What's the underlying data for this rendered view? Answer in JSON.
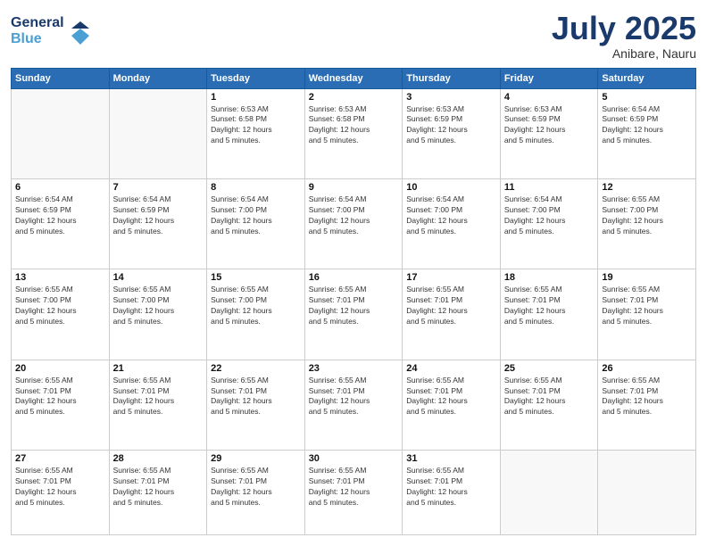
{
  "logo": {
    "line1": "General",
    "line2": "Blue"
  },
  "title": "July 2025",
  "location": "Anibare, Nauru",
  "days_header": [
    "Sunday",
    "Monday",
    "Tuesday",
    "Wednesday",
    "Thursday",
    "Friday",
    "Saturday"
  ],
  "weeks": [
    [
      {
        "day": "",
        "info": ""
      },
      {
        "day": "",
        "info": ""
      },
      {
        "day": "1",
        "info": "Sunrise: 6:53 AM\nSunset: 6:58 PM\nDaylight: 12 hours\nand 5 minutes."
      },
      {
        "day": "2",
        "info": "Sunrise: 6:53 AM\nSunset: 6:58 PM\nDaylight: 12 hours\nand 5 minutes."
      },
      {
        "day": "3",
        "info": "Sunrise: 6:53 AM\nSunset: 6:59 PM\nDaylight: 12 hours\nand 5 minutes."
      },
      {
        "day": "4",
        "info": "Sunrise: 6:53 AM\nSunset: 6:59 PM\nDaylight: 12 hours\nand 5 minutes."
      },
      {
        "day": "5",
        "info": "Sunrise: 6:54 AM\nSunset: 6:59 PM\nDaylight: 12 hours\nand 5 minutes."
      }
    ],
    [
      {
        "day": "6",
        "info": "Sunrise: 6:54 AM\nSunset: 6:59 PM\nDaylight: 12 hours\nand 5 minutes."
      },
      {
        "day": "7",
        "info": "Sunrise: 6:54 AM\nSunset: 6:59 PM\nDaylight: 12 hours\nand 5 minutes."
      },
      {
        "day": "8",
        "info": "Sunrise: 6:54 AM\nSunset: 7:00 PM\nDaylight: 12 hours\nand 5 minutes."
      },
      {
        "day": "9",
        "info": "Sunrise: 6:54 AM\nSunset: 7:00 PM\nDaylight: 12 hours\nand 5 minutes."
      },
      {
        "day": "10",
        "info": "Sunrise: 6:54 AM\nSunset: 7:00 PM\nDaylight: 12 hours\nand 5 minutes."
      },
      {
        "day": "11",
        "info": "Sunrise: 6:54 AM\nSunset: 7:00 PM\nDaylight: 12 hours\nand 5 minutes."
      },
      {
        "day": "12",
        "info": "Sunrise: 6:55 AM\nSunset: 7:00 PM\nDaylight: 12 hours\nand 5 minutes."
      }
    ],
    [
      {
        "day": "13",
        "info": "Sunrise: 6:55 AM\nSunset: 7:00 PM\nDaylight: 12 hours\nand 5 minutes."
      },
      {
        "day": "14",
        "info": "Sunrise: 6:55 AM\nSunset: 7:00 PM\nDaylight: 12 hours\nand 5 minutes."
      },
      {
        "day": "15",
        "info": "Sunrise: 6:55 AM\nSunset: 7:00 PM\nDaylight: 12 hours\nand 5 minutes."
      },
      {
        "day": "16",
        "info": "Sunrise: 6:55 AM\nSunset: 7:01 PM\nDaylight: 12 hours\nand 5 minutes."
      },
      {
        "day": "17",
        "info": "Sunrise: 6:55 AM\nSunset: 7:01 PM\nDaylight: 12 hours\nand 5 minutes."
      },
      {
        "day": "18",
        "info": "Sunrise: 6:55 AM\nSunset: 7:01 PM\nDaylight: 12 hours\nand 5 minutes."
      },
      {
        "day": "19",
        "info": "Sunrise: 6:55 AM\nSunset: 7:01 PM\nDaylight: 12 hours\nand 5 minutes."
      }
    ],
    [
      {
        "day": "20",
        "info": "Sunrise: 6:55 AM\nSunset: 7:01 PM\nDaylight: 12 hours\nand 5 minutes."
      },
      {
        "day": "21",
        "info": "Sunrise: 6:55 AM\nSunset: 7:01 PM\nDaylight: 12 hours\nand 5 minutes."
      },
      {
        "day": "22",
        "info": "Sunrise: 6:55 AM\nSunset: 7:01 PM\nDaylight: 12 hours\nand 5 minutes."
      },
      {
        "day": "23",
        "info": "Sunrise: 6:55 AM\nSunset: 7:01 PM\nDaylight: 12 hours\nand 5 minutes."
      },
      {
        "day": "24",
        "info": "Sunrise: 6:55 AM\nSunset: 7:01 PM\nDaylight: 12 hours\nand 5 minutes."
      },
      {
        "day": "25",
        "info": "Sunrise: 6:55 AM\nSunset: 7:01 PM\nDaylight: 12 hours\nand 5 minutes."
      },
      {
        "day": "26",
        "info": "Sunrise: 6:55 AM\nSunset: 7:01 PM\nDaylight: 12 hours\nand 5 minutes."
      }
    ],
    [
      {
        "day": "27",
        "info": "Sunrise: 6:55 AM\nSunset: 7:01 PM\nDaylight: 12 hours\nand 5 minutes."
      },
      {
        "day": "28",
        "info": "Sunrise: 6:55 AM\nSunset: 7:01 PM\nDaylight: 12 hours\nand 5 minutes."
      },
      {
        "day": "29",
        "info": "Sunrise: 6:55 AM\nSunset: 7:01 PM\nDaylight: 12 hours\nand 5 minutes."
      },
      {
        "day": "30",
        "info": "Sunrise: 6:55 AM\nSunset: 7:01 PM\nDaylight: 12 hours\nand 5 minutes."
      },
      {
        "day": "31",
        "info": "Sunrise: 6:55 AM\nSunset: 7:01 PM\nDaylight: 12 hours\nand 5 minutes."
      },
      {
        "day": "",
        "info": ""
      },
      {
        "day": "",
        "info": ""
      }
    ]
  ]
}
